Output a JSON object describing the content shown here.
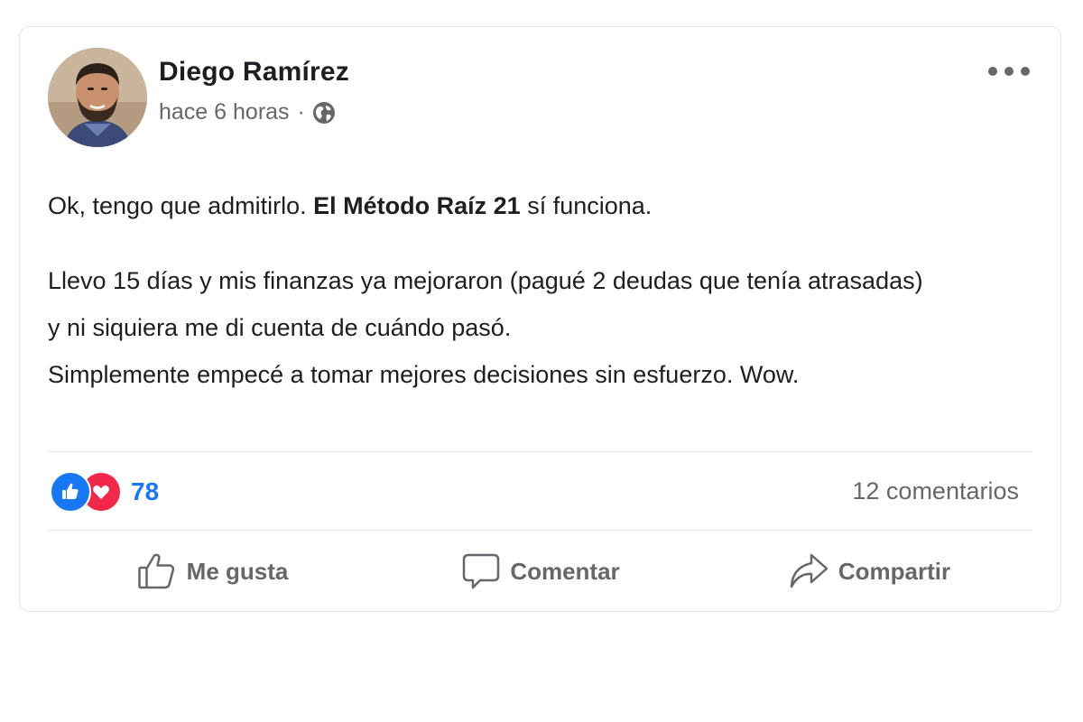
{
  "post": {
    "author": "Diego Ramírez",
    "timestamp": "hace 6 horas",
    "separator": "·",
    "privacy_icon": "globe-icon",
    "more_icon": "more-options-icon",
    "body": {
      "line1_start": "Ok, tengo que admitirlo. ",
      "line1_bold": "El Método Raíz 21",
      "line1_end": " sí funciona.",
      "line2": "Llevo 15 días y mis finanzas ya mejoraron (pagué 2 deudas que tenía atrasadas)",
      "line3": "y ni siquiera me di cuenta de cuándo pasó.",
      "line4": "Simplemente empecé a tomar mejores decisiones sin esfuerzo. Wow."
    }
  },
  "stats": {
    "reaction_icons": [
      "like-icon",
      "love-icon"
    ],
    "reaction_count": "78",
    "comments": "12 comentarios"
  },
  "actions": {
    "like_label": "Me gusta",
    "comment_label": "Comentar",
    "share_label": "Compartir"
  },
  "colors": {
    "accent": "#1877f2",
    "love": "#f02849",
    "secondary_text": "#65676b",
    "primary_text": "#1c1e21",
    "divider": "#e4e6eb"
  }
}
